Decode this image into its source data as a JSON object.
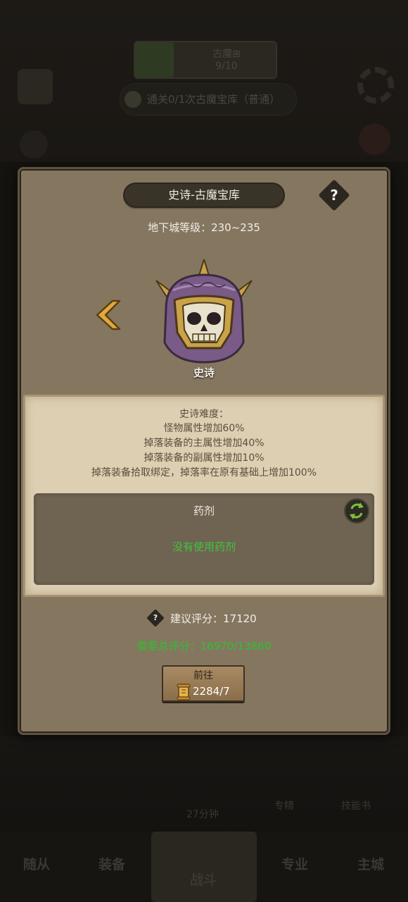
{
  "background": {
    "progress_title": "古魔⊞",
    "progress_value": "9/10",
    "quest_text": "通关0/1次古魔宝库（普通）",
    "bottom_tabs": [
      "随从",
      "装备",
      "战斗",
      "专业",
      "主城"
    ],
    "bottom_hint": "27分钟",
    "bottom_side_labels": [
      "专精",
      "技能书"
    ]
  },
  "dialog": {
    "title": "史诗-古魔宝库",
    "help_symbol": "?",
    "dungeon_level": "地下城等级：230~235",
    "difficulty_name": "史诗",
    "description": [
      "史诗难度：",
      "怪物属性增加60%",
      "掉落装备的主属性增加40%",
      "掉落装备的副属性增加10%",
      "掉落装备拾取绑定，掉落率在原有基础上增加100%"
    ],
    "potion": {
      "title": "药剂",
      "empty_text": "没有使用药剂"
    },
    "recommended_score": "建议评分：17120",
    "required_total_score": "需要总评分：16970/13860",
    "go_button": {
      "label": "前往",
      "cost": "2284/7"
    }
  },
  "colors": {
    "panel": "#857660",
    "parchment": "#ddcfb2",
    "accent_green": "#2fc02f",
    "gold_arrow": "#e0a93a",
    "helmet_purple": "#7a5a86"
  },
  "icons": [
    "left-arrow-icon",
    "help-icon",
    "skull-helmet-icon",
    "swap-icon",
    "scroll-icon"
  ]
}
